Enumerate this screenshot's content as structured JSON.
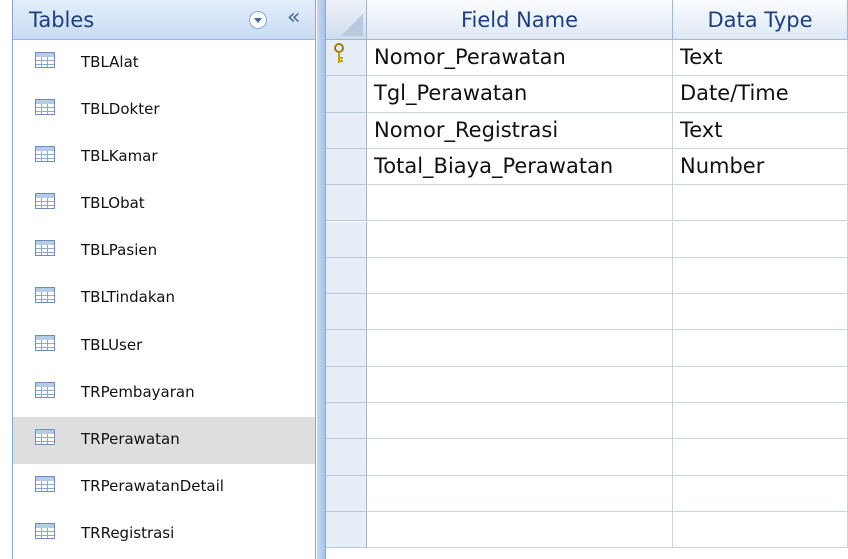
{
  "nav": {
    "title": "Tables",
    "items": [
      {
        "label": "TBLAlat",
        "selected": false
      },
      {
        "label": "TBLDokter",
        "selected": false
      },
      {
        "label": "TBLKamar",
        "selected": false
      },
      {
        "label": "TBLObat",
        "selected": false
      },
      {
        "label": "TBLPasien",
        "selected": false
      },
      {
        "label": "TBLTindakan",
        "selected": false
      },
      {
        "label": "TBLUser",
        "selected": false
      },
      {
        "label": "TRPembayaran",
        "selected": false
      },
      {
        "label": "TRPerawatan",
        "selected": true
      },
      {
        "label": "TRPerawatanDetail",
        "selected": false
      },
      {
        "label": "TRRegistrasi",
        "selected": false
      }
    ],
    "icons": {
      "dropdown": "chevron-down-circle-icon",
      "collapse": "double-chevron-left-icon",
      "item": "table-icon"
    }
  },
  "grid": {
    "headers": {
      "field_name": "Field Name",
      "data_type": "Data Type"
    },
    "rows": [
      {
        "field": "Nomor_Perawatan",
        "type": "Text",
        "primary_key": true
      },
      {
        "field": "Tgl_Perawatan",
        "type": "Date/Time",
        "primary_key": false
      },
      {
        "field": "Nomor_Registrasi",
        "type": "Text",
        "primary_key": false
      },
      {
        "field": "Total_Biaya_Perawatan",
        "type": "Number",
        "primary_key": false
      },
      {
        "field": "",
        "type": "",
        "primary_key": false
      },
      {
        "field": "",
        "type": "",
        "primary_key": false
      },
      {
        "field": "",
        "type": "",
        "primary_key": false
      },
      {
        "field": "",
        "type": "",
        "primary_key": false
      },
      {
        "field": "",
        "type": "",
        "primary_key": false
      },
      {
        "field": "",
        "type": "",
        "primary_key": false
      },
      {
        "field": "",
        "type": "",
        "primary_key": false
      },
      {
        "field": "",
        "type": "",
        "primary_key": false
      },
      {
        "field": "",
        "type": "",
        "primary_key": false
      },
      {
        "field": "",
        "type": "",
        "primary_key": false
      }
    ]
  },
  "colors": {
    "header_text": "#1f3e7c",
    "selected_row": "#dedede",
    "border": "#8aa7cd"
  }
}
